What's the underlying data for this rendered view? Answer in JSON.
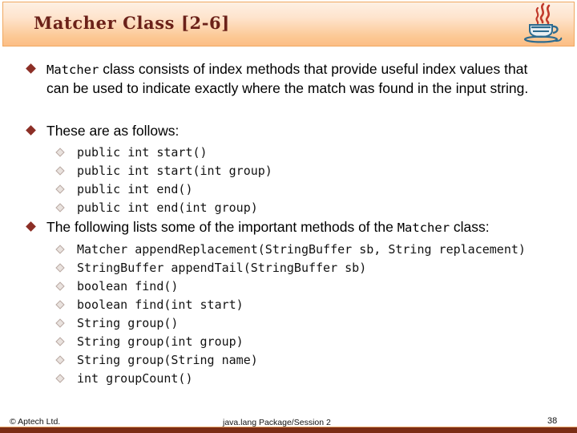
{
  "theme": {
    "title_color": "#6b2119",
    "header_gradient_top": "#fdf0e4",
    "header_gradient_bottom": "#fcbe86",
    "header_border": "#f0a861",
    "bullet_color": "#8c2f26",
    "footer_bar_color": "#7b2d15",
    "body_text_color": "#000000"
  },
  "header": {
    "title": "Matcher Class [2-6]",
    "logo_icon": "java-coffee-cup-logo"
  },
  "content": {
    "bullet_1": {
      "mono_lead": "Matcher",
      "text": " class consists of index methods that provide useful index values that can be used to indicate exactly where the match was found in the input string."
    },
    "bullet_2": {
      "text": "These are as follows:"
    },
    "methods_basic": [
      "public int start()",
      "public int start(int group)",
      "public int end()",
      "public int end(int group)"
    ],
    "bullet_3": {
      "text_before": "The following lists some of the important methods of the ",
      "mono_term": "Matcher",
      "text_after": " class:"
    },
    "methods_important": [
      "Matcher appendReplacement(StringBuffer sb, String replacement)",
      "StringBuffer appendTail(StringBuffer sb)",
      "boolean find()",
      "boolean find(int start)",
      "String group()",
      "String group(int group)",
      "String group(String name)",
      "int groupCount()"
    ]
  },
  "footer": {
    "copyright": "© Aptech Ltd.",
    "center": "java.lang Package/Session 2",
    "page_number": "38"
  }
}
